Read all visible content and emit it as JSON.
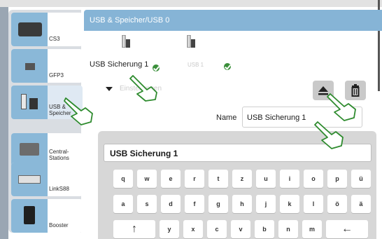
{
  "header": {
    "title": "USB & Speicher/USB 0"
  },
  "sidebar": {
    "items": [
      {
        "label": "CS3",
        "icon": "cs3-device-icon"
      },
      {
        "label": "GFP3",
        "icon": "gfp3-device-icon"
      },
      {
        "label": "USB & Speicher",
        "icon": "usb-storage-icon",
        "active": true
      },
      {
        "label": "Central-Stations",
        "icon": "central-station-icon"
      },
      {
        "label": "LinkS88",
        "icon": "links88-device-icon"
      },
      {
        "label": "Booster",
        "icon": "booster-device-icon"
      }
    ]
  },
  "devices": [
    {
      "label": "USB Sicherung 1",
      "status": "connected"
    },
    {
      "label": "USB 1",
      "status": "connected"
    }
  ],
  "settings": {
    "toggle_label": "Einstellungen"
  },
  "actions": {
    "eject": "eject-icon",
    "delete": "trash-icon"
  },
  "name_field": {
    "label": "Name",
    "value": "USB Sicherung 1"
  },
  "keyboard": {
    "input_value": "USB Sicherung 1",
    "rows": [
      [
        "q",
        "w",
        "e",
        "r",
        "t",
        "z",
        "u",
        "i",
        "o",
        "p",
        "ü"
      ],
      [
        "a",
        "s",
        "d",
        "f",
        "g",
        "h",
        "j",
        "k",
        "l",
        "ö",
        "ä"
      ],
      [
        "↑",
        "y",
        "x",
        "c",
        "v",
        "b",
        "n",
        "m",
        "←"
      ]
    ]
  },
  "colors": {
    "accent": "#86b4d6",
    "status_ok": "#3a8f3a",
    "sidebar_bg": "#d9dde2",
    "keyboard_bg": "#d7d7d7"
  }
}
